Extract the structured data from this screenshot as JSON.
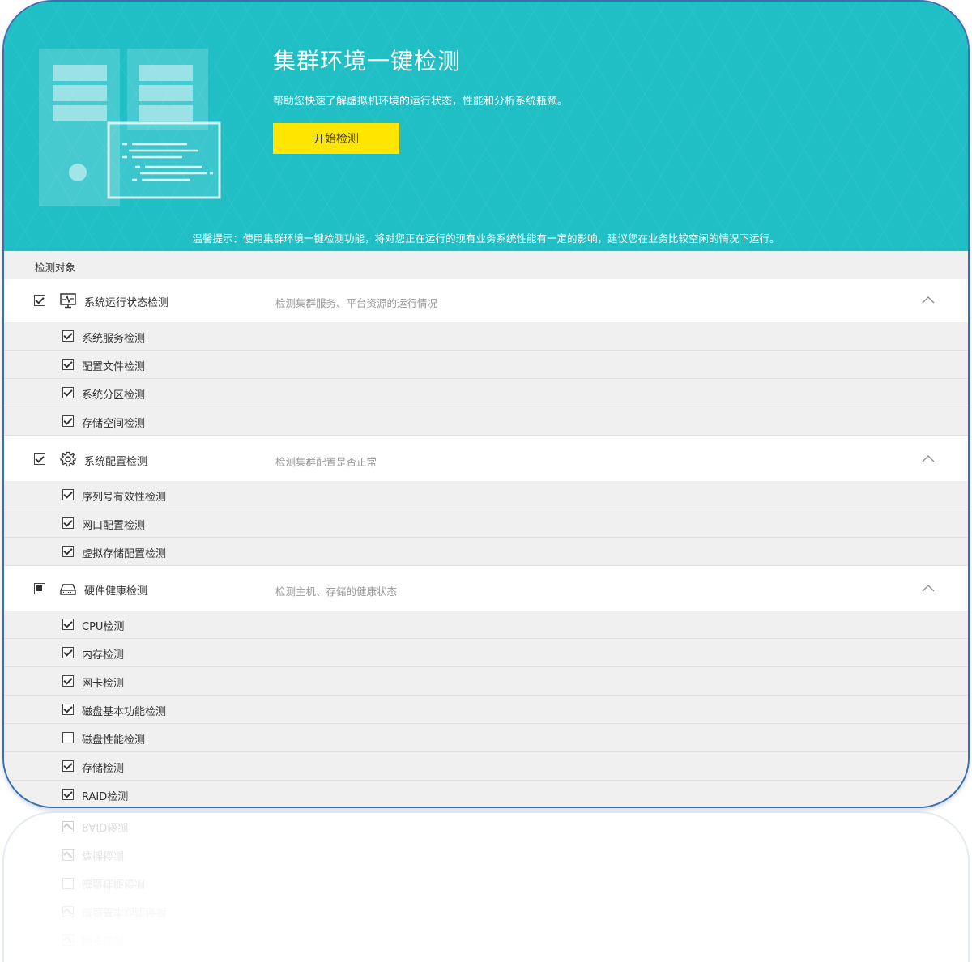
{
  "banner": {
    "title": "集群环境一键检测",
    "subtitle": "帮助您快速了解虚拟机环境的运行状态，性能和分析系统瓶颈。",
    "start_button": "开始检测",
    "tip": "温馨提示：使用集群环境一键检测功能，将对您正在运行的现有业务系统性能有一定的影响，建议您在业务比较空闲的情况下运行。"
  },
  "list": {
    "header": "检测对象",
    "groups": [
      {
        "label": "系统运行状态检测",
        "description": "检测集群服务、平台资源的运行情况",
        "icon": "monitor-pulse-icon",
        "state": "checked",
        "items": [
          {
            "label": "系统服务检测",
            "checked": true
          },
          {
            "label": "配置文件检测",
            "checked": true
          },
          {
            "label": "系统分区检测",
            "checked": true
          },
          {
            "label": "存储空间检测",
            "checked": true
          }
        ]
      },
      {
        "label": "系统配置检测",
        "description": "检测集群配置是否正常",
        "icon": "gear-icon",
        "state": "checked",
        "items": [
          {
            "label": "序列号有效性检测",
            "checked": true
          },
          {
            "label": "网口配置检测",
            "checked": true
          },
          {
            "label": "虚拟存储配置检测",
            "checked": true
          }
        ]
      },
      {
        "label": "硬件健康检测",
        "description": "检测主机、存储的健康状态",
        "icon": "hard-drive-icon",
        "state": "partial",
        "items": [
          {
            "label": "CPU检测",
            "checked": true
          },
          {
            "label": "内存检测",
            "checked": true
          },
          {
            "label": "网卡检测",
            "checked": true
          },
          {
            "label": "磁盘基本功能检测",
            "checked": true
          },
          {
            "label": "磁盘性能检测",
            "checked": false
          },
          {
            "label": "存储检测",
            "checked": true
          },
          {
            "label": "RAID检测",
            "checked": true
          }
        ]
      }
    ]
  }
}
